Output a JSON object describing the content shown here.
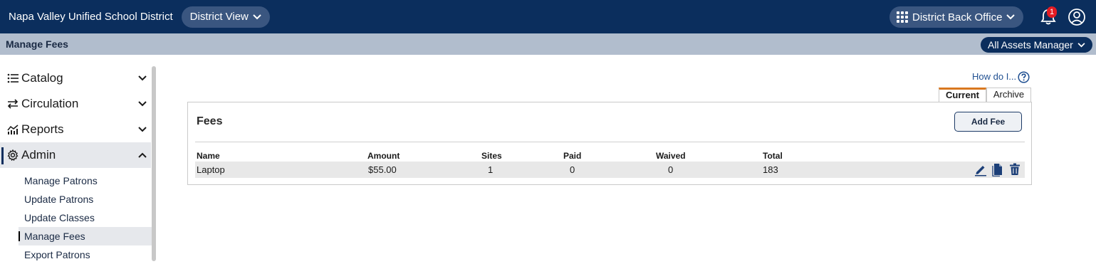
{
  "header": {
    "district_name": "Napa Valley Unified School District",
    "view_label": "District View",
    "app_switcher_label": "District Back Office",
    "notification_count": "1"
  },
  "subbar": {
    "page_title": "Manage Fees",
    "role_label": "All Assets Manager"
  },
  "sidebar": {
    "items": [
      {
        "label": "Catalog",
        "icon": "list-icon",
        "expanded": false
      },
      {
        "label": "Circulation",
        "icon": "swap-arrows-icon",
        "expanded": false
      },
      {
        "label": "Reports",
        "icon": "chart-icon",
        "expanded": false
      },
      {
        "label": "Admin",
        "icon": "gear-icon",
        "expanded": true
      }
    ],
    "admin_subitems": [
      {
        "label": "Manage Patrons"
      },
      {
        "label": "Update Patrons"
      },
      {
        "label": "Update Classes"
      },
      {
        "label": "Manage Fees",
        "active": true
      },
      {
        "label": "Export Patrons"
      }
    ]
  },
  "main": {
    "help_link": "How do I...",
    "tabs": [
      {
        "label": "Current",
        "active": true
      },
      {
        "label": "Archive",
        "active": false
      }
    ],
    "panel_title": "Fees",
    "add_button": "Add Fee",
    "table": {
      "headers": [
        "Name",
        "Amount",
        "Sites",
        "Paid",
        "Waived",
        "Total"
      ],
      "rows": [
        {
          "name": "Laptop",
          "amount": "$55.00",
          "sites": "1",
          "paid": "0",
          "waived": "0",
          "total": "183"
        }
      ],
      "row_actions": [
        "edit-icon",
        "copy-icon",
        "trash-icon"
      ]
    }
  },
  "colors": {
    "header_bg": "#0b2e5d",
    "subbar_bg": "#b1bdcd",
    "tab_accent": "#d9781f",
    "badge": "#e41b23"
  }
}
